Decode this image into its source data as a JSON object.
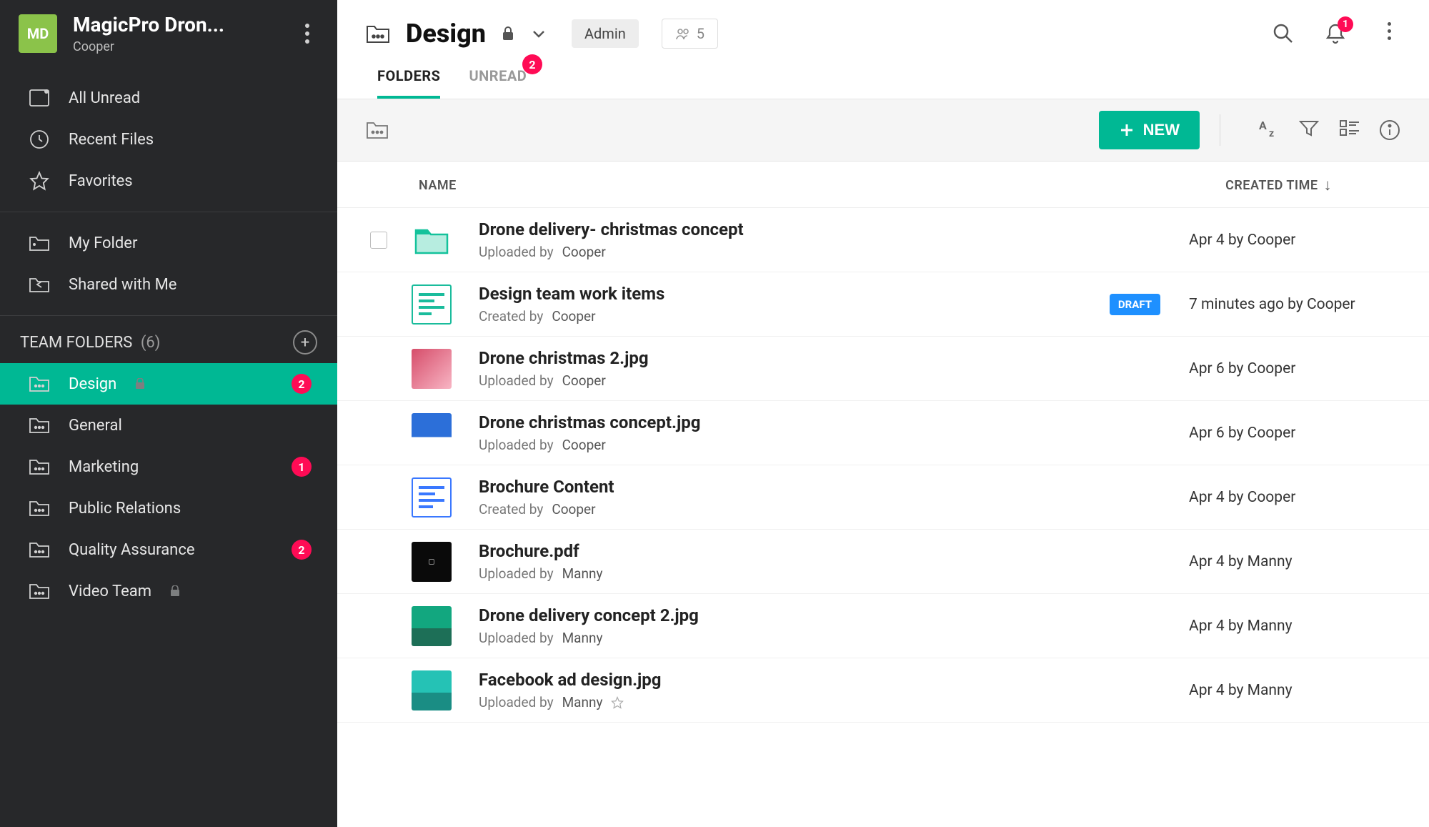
{
  "workspace": {
    "badge": "MD",
    "title": "MagicPro Dron...",
    "subtitle": "Cooper"
  },
  "sidebar": {
    "quick": [
      {
        "label": "All Unread",
        "icon": "inbox"
      },
      {
        "label": "Recent Files",
        "icon": "clock"
      },
      {
        "label": "Favorites",
        "icon": "star"
      }
    ],
    "personal": [
      {
        "label": "My Folder",
        "icon": "folder"
      },
      {
        "label": "Shared with Me",
        "icon": "shared"
      }
    ],
    "teamHeader": "TEAM FOLDERS",
    "teamCount": "(6)",
    "team": [
      {
        "label": "Design",
        "locked": true,
        "badge": "2",
        "active": true
      },
      {
        "label": "General"
      },
      {
        "label": "Marketing",
        "badge": "1"
      },
      {
        "label": "Public Relations"
      },
      {
        "label": "Quality Assurance",
        "badge": "2"
      },
      {
        "label": "Video Team",
        "locked": true
      }
    ]
  },
  "header": {
    "title": "Design",
    "roleLabel": "Admin",
    "memberCount": "5",
    "bellBadge": "1"
  },
  "tabs": {
    "folders": "FOLDERS",
    "unread": "UNREAD",
    "unreadBadge": "2"
  },
  "toolbar": {
    "newLabel": "NEW"
  },
  "columns": {
    "name": "NAME",
    "created": "CREATED TIME"
  },
  "files": [
    {
      "name": "Drone delivery- christmas concept",
      "meta": "Uploaded by",
      "who": "Cooper",
      "time": "Apr 4 by Cooper",
      "thumb": "folder"
    },
    {
      "name": "Design team work items",
      "meta": "Created by",
      "who": "Cooper",
      "time": "7 minutes ago by Cooper",
      "thumb": "sheet",
      "badge": "DRAFT"
    },
    {
      "name": "Drone christmas 2.jpg",
      "meta": "Uploaded by",
      "who": "Cooper",
      "time": "Apr 6 by Cooper",
      "thumb": "img1"
    },
    {
      "name": "Drone christmas concept.jpg",
      "meta": "Uploaded by",
      "who": "Cooper",
      "time": "Apr 6 by Cooper",
      "thumb": "img2"
    },
    {
      "name": "Brochure Content",
      "meta": "Created by",
      "who": "Cooper",
      "time": "Apr 4 by Cooper",
      "thumb": "doc"
    },
    {
      "name": "Brochure.pdf",
      "meta": "Uploaded by",
      "who": "Manny",
      "time": "Apr 4 by Manny",
      "thumb": "pdf"
    },
    {
      "name": "Drone delivery concept 2.jpg",
      "meta": "Uploaded by",
      "who": "Manny",
      "time": "Apr 4 by Manny",
      "thumb": "img3"
    },
    {
      "name": "Facebook ad design.jpg",
      "meta": "Uploaded by",
      "who": "Manny",
      "time": "Apr 4 by Manny",
      "thumb": "img4",
      "star": true
    }
  ]
}
